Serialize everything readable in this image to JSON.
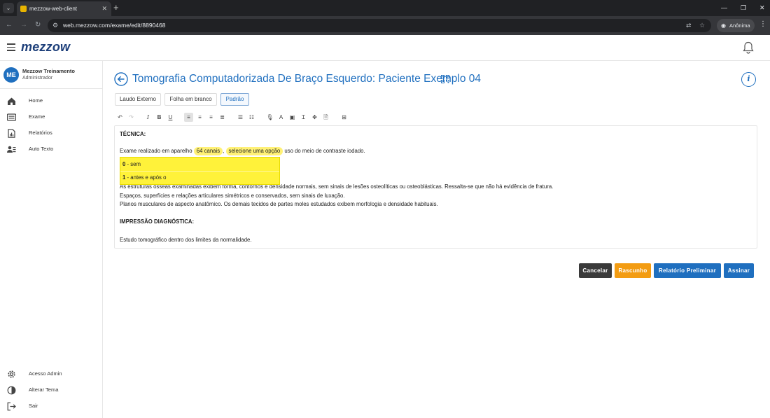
{
  "browser": {
    "tab_title": "mezzow-web-client",
    "url": "web.mezzow.com/exame/edit/8890468",
    "profile_label": "Anônima"
  },
  "app": {
    "logo": "mezzow"
  },
  "user": {
    "initials": "ME",
    "name": "Mezzow Treinamento",
    "role": "Administrador"
  },
  "sidebar": {
    "items": [
      {
        "label": "Home",
        "icon": "home-icon"
      },
      {
        "label": "Exame",
        "icon": "list-icon"
      },
      {
        "label": "Relatórios",
        "icon": "report-icon"
      },
      {
        "label": "Auto Texto",
        "icon": "auto-text-icon"
      }
    ],
    "bottom_items": [
      {
        "label": "Acesso Admin",
        "icon": "gear-icon"
      },
      {
        "label": "Alterar Tema",
        "icon": "theme-icon"
      },
      {
        "label": "Sair",
        "icon": "logout-icon"
      }
    ]
  },
  "page": {
    "title": "Tomografia Computadorizada De Braço Esquerdo: Paciente Exemplo 04",
    "info_label": "i"
  },
  "template_tabs": [
    {
      "label": "Laudo Externo",
      "active": false
    },
    {
      "label": "Folha em branco",
      "active": false
    },
    {
      "label": "Padrão",
      "active": true
    }
  ],
  "editor": {
    "tecnica_heading": "TÉCNICA:",
    "line1_prefix": "Exame realizado em aparelho",
    "chip1": "64 canais",
    "comma": ",",
    "chip2": "selecione uma opção",
    "line1_suffix": "uso do meio de contraste iodado.",
    "dropdown_options": [
      {
        "key": "0",
        "text": "- sem"
      },
      {
        "key": "1",
        "text": "- antes e após o"
      }
    ],
    "body_lines": [
      "As estruturas ósseas examinadas exibem forma, contornos e densidade normais, sem sinais de lesões osteolíticas ou osteoblásticas. Ressalta-se que não há evidência de fratura.",
      "Espaços, superfícies e relações articulares simétricos e conservados, sem sinais de luxação.",
      "Planos musculares de aspecto anatômico. Os demais tecidos de partes moles estudados exibem morfologia e densidade habituais."
    ],
    "impressao_heading": "IMPRESSÃO DIAGNÓSTICA:",
    "conclusion": "Estudo tomográfico dentro dos limites da normalidade."
  },
  "actions": {
    "cancel": "Cancelar",
    "draft": "Rascunho",
    "preliminary": "Relatório Preliminar",
    "sign": "Assinar"
  },
  "colors": {
    "primary": "#1f6fbf",
    "cancel": "#3a3a3a",
    "draft": "#f39c12",
    "highlight": "#fff23a"
  }
}
